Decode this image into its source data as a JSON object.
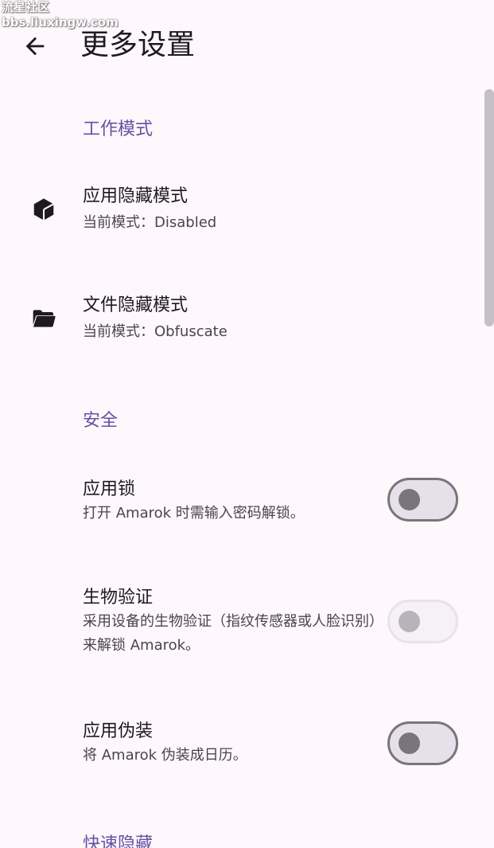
{
  "watermark": {
    "line1": "流星社区",
    "line2": "bbs.liuxingw.com"
  },
  "header": {
    "title": "更多设置",
    "back_icon": "arrow-left-icon"
  },
  "sections": {
    "work_mode": {
      "header": "工作模式",
      "app_hide": {
        "icon": "cube-icon",
        "title": "应用隐藏模式",
        "subtitle": "当前模式：Disabled"
      },
      "file_hide": {
        "icon": "folder-open-icon",
        "title": "文件隐藏模式",
        "subtitle": "当前模式：Obfuscate"
      }
    },
    "security": {
      "header": "安全",
      "app_lock": {
        "title": "应用锁",
        "subtitle": "打开 Amarok 时需输入密码解锁。",
        "enabled": true,
        "checked": false
      },
      "biometric": {
        "title": "生物验证",
        "subtitle": "采用设备的生物验证（指纹传感器或人脸识别）来解锁 Amarok。",
        "enabled": false,
        "checked": false
      },
      "disguise": {
        "title": "应用伪装",
        "subtitle": "将 Amarok 伪装成日历。",
        "enabled": true,
        "checked": false
      }
    },
    "quick_hide": {
      "header": "快速隐藏"
    }
  },
  "colors": {
    "background": "#fef7fc",
    "accent": "#6750a4",
    "text_primary": "#1d1b20",
    "text_secondary": "#49454f",
    "switch_outline": "#79747e",
    "switch_track": "#e6e0e9"
  }
}
